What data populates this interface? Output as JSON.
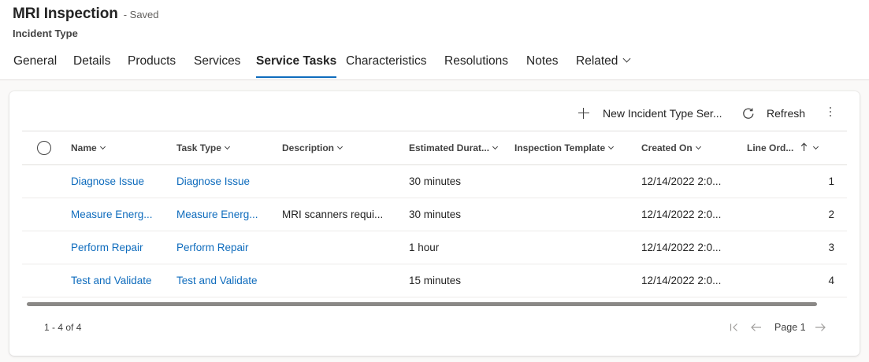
{
  "header": {
    "title": "MRI Inspection",
    "saved_status": "- Saved",
    "subtitle": "Incident Type"
  },
  "tabs": [
    {
      "label": "General",
      "active": false
    },
    {
      "label": "Details",
      "active": false
    },
    {
      "label": "Products",
      "active": false
    },
    {
      "label": "Services",
      "active": false
    },
    {
      "label": "Service Tasks",
      "active": true
    },
    {
      "label": "Characteristics",
      "active": false
    },
    {
      "label": "Resolutions",
      "active": false
    },
    {
      "label": "Notes",
      "active": false
    },
    {
      "label": "Related",
      "active": false
    }
  ],
  "toolbar": {
    "new_label": "New Incident Type Ser...",
    "refresh_label": "Refresh"
  },
  "grid": {
    "columns": [
      {
        "label": "Name"
      },
      {
        "label": "Task Type"
      },
      {
        "label": "Description"
      },
      {
        "label": "Estimated Durat..."
      },
      {
        "label": "Inspection Template"
      },
      {
        "label": "Created On"
      },
      {
        "label": "Line Ord..."
      }
    ],
    "rows": [
      {
        "name": "Diagnose Issue",
        "task_type": "Diagnose Issue",
        "description": "",
        "duration": "30 minutes",
        "template": "",
        "created_on": "12/14/2022 2:0...",
        "line_order": "1"
      },
      {
        "name": "Measure Energ...",
        "task_type": "Measure Energ...",
        "description": "MRI scanners requi...",
        "duration": "30 minutes",
        "template": "",
        "created_on": "12/14/2022 2:0...",
        "line_order": "2"
      },
      {
        "name": "Perform Repair",
        "task_type": "Perform Repair",
        "description": "",
        "duration": "1 hour",
        "template": "",
        "created_on": "12/14/2022 2:0...",
        "line_order": "3"
      },
      {
        "name": "Test and Validate",
        "task_type": "Test and Validate",
        "description": "",
        "duration": "15 minutes",
        "template": "",
        "created_on": "12/14/2022 2:0...",
        "line_order": "4"
      }
    ]
  },
  "footer": {
    "count": "1 - 4 of 4",
    "page_label": "Page 1"
  },
  "colors": {
    "accent": "#0f6cbd",
    "text": "#242424"
  }
}
